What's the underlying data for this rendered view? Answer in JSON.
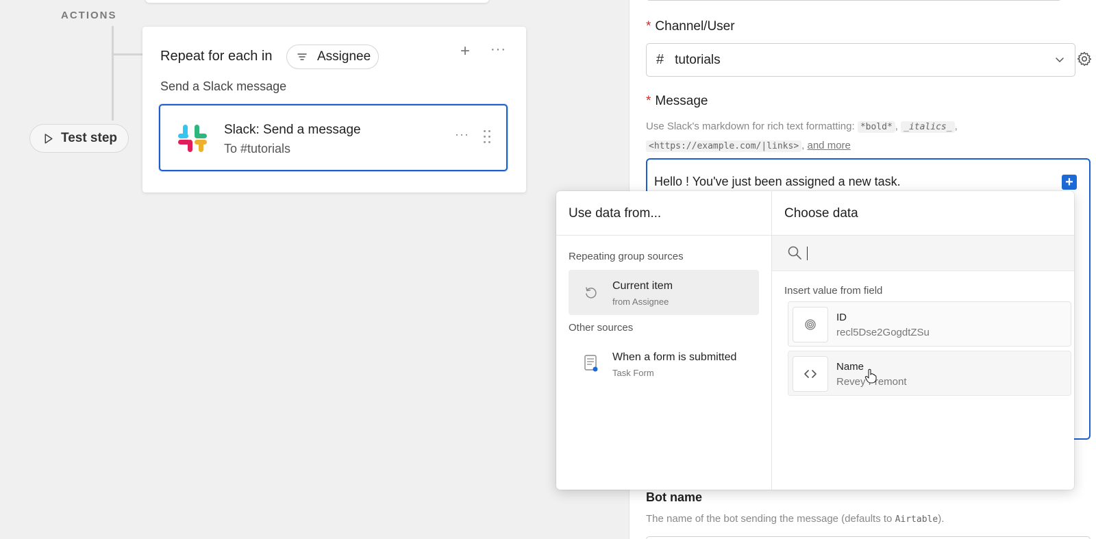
{
  "canvas": {
    "section_label": "ACTIONS",
    "test_step_label": "Test step",
    "repeat_card": {
      "title": "Repeat for each in",
      "pill_label": "Assignee",
      "plus": "+",
      "more": "···",
      "subtitle": "Send a Slack message"
    },
    "slack_step": {
      "title": "Slack: Send a message",
      "subtitle": "To #tutorials",
      "more": "···"
    }
  },
  "panel": {
    "channel": {
      "label": "Channel/User",
      "required_mark": "*",
      "prefix": "#",
      "value": "tutorials"
    },
    "message": {
      "label": "Message",
      "required_mark": "*",
      "hint_prefix": "Use Slack's markdown for rich text formatting:",
      "hint_bold": "*bold*",
      "hint_italics": "_italics_",
      "hint_links": "<https://example.com/|links>",
      "hint_more": "and more",
      "comma": ",",
      "value": "Hello ! You've just been assigned a new task.",
      "insert_label": "+"
    },
    "bot_name": {
      "label": "Bot name",
      "hint_prefix": "The name of the bot sending the message (defaults to",
      "hint_code": "Airtable",
      "hint_suffix": ")."
    }
  },
  "popup": {
    "left_title": "Use data from...",
    "right_title": "Choose data",
    "groups": [
      {
        "label": "Repeating group sources",
        "items": [
          {
            "title": "Current item",
            "sub": "from Assignee"
          }
        ]
      },
      {
        "label": "Other sources",
        "items": [
          {
            "title": "When a form is submitted",
            "sub": "Task Form"
          }
        ]
      }
    ],
    "search": {
      "placeholder": ""
    },
    "insert_label": "Insert value from field",
    "fields": [
      {
        "name": "ID",
        "value": "recl5Dse2GogdtZSu"
      },
      {
        "name": "Name",
        "value": "Revey Fremont"
      }
    ]
  },
  "colors": {
    "accent": "#1b5fcc",
    "required": "#d02b2b"
  }
}
